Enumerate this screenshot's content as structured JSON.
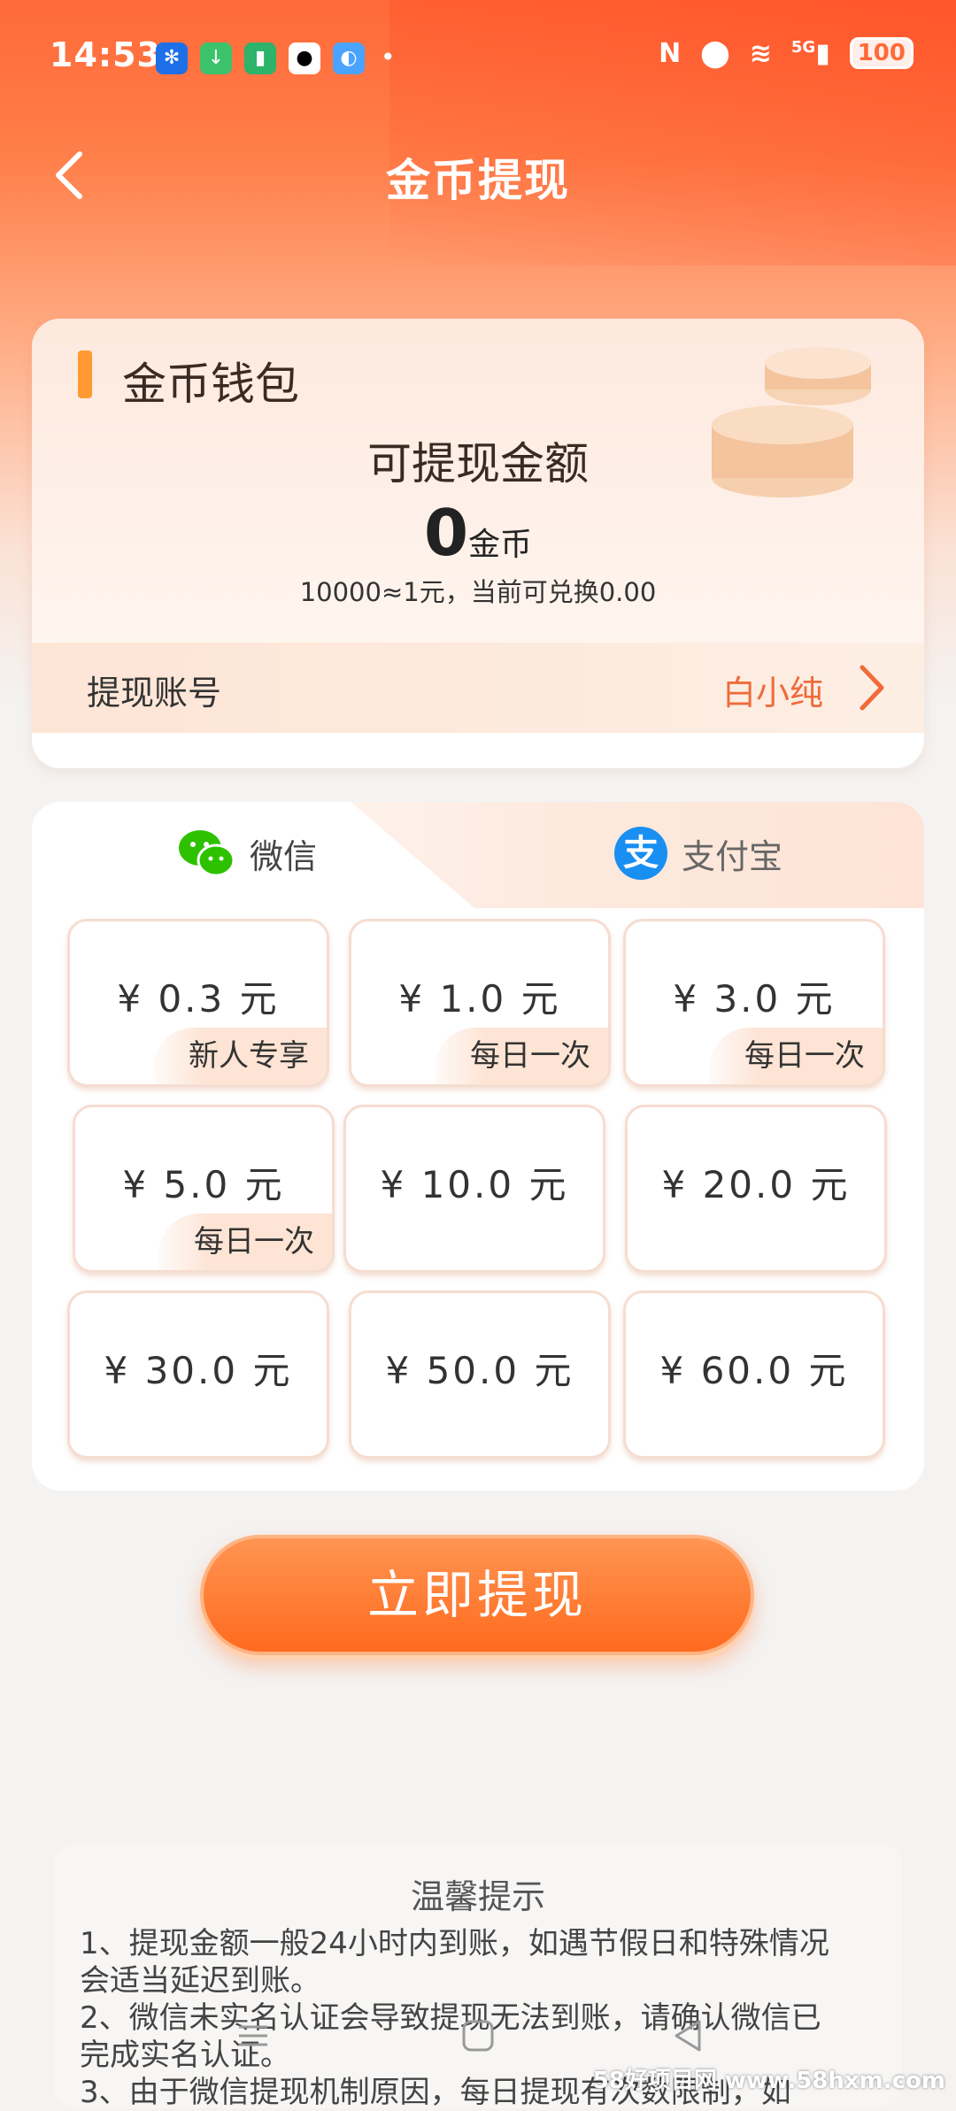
{
  "status_bar": {
    "time": "14:53",
    "battery": "100",
    "network": "5G"
  },
  "header": {
    "title": "金币提现"
  },
  "wallet": {
    "section_title": "金币钱包",
    "available_label": "可提现金额",
    "balance_value": "0",
    "balance_unit": "金币",
    "rate_text": "10000≈1元，当前可兑换0.00",
    "account_label": "提现账号",
    "account_value": "白小纯"
  },
  "payment_tabs": [
    {
      "label": "微信",
      "icon": "wechat-icon",
      "active": true
    },
    {
      "label": "支付宝",
      "icon": "alipay-icon",
      "active": false
    }
  ],
  "alipay_glyph": "支",
  "options": [
    {
      "amount": "¥ 0.3 元",
      "tag": "新人专享"
    },
    {
      "amount": "¥ 1.0 元",
      "tag": "每日一次"
    },
    {
      "amount": "¥ 3.0 元",
      "tag": "每日一次"
    },
    {
      "amount": "¥ 5.0 元",
      "tag": "每日一次"
    },
    {
      "amount": "¥ 10.0 元",
      "tag": ""
    },
    {
      "amount": "¥ 20.0 元",
      "tag": ""
    },
    {
      "amount": "¥ 30.0 元",
      "tag": ""
    },
    {
      "amount": "¥ 50.0 元",
      "tag": ""
    },
    {
      "amount": "¥ 60.0 元",
      "tag": ""
    }
  ],
  "withdraw_button": "立即提现",
  "tips": {
    "title": "温馨提示",
    "lines": [
      "1、提现金额一般24小时内到账，如遇节假日和特殊情况",
      "会适当延迟到账。",
      "2、微信未实名认证会导致提现无法到账，请确认微信已",
      "完成实名认证。",
      "3、由于微信提现机制原因，每日提现有次数限制，如"
    ]
  },
  "watermark": "58好项目网 www.58hxm.com",
  "colors": {
    "accent": "#ff6a1e",
    "account_value": "#f06a3a",
    "section_bar": "#ff9a33"
  }
}
